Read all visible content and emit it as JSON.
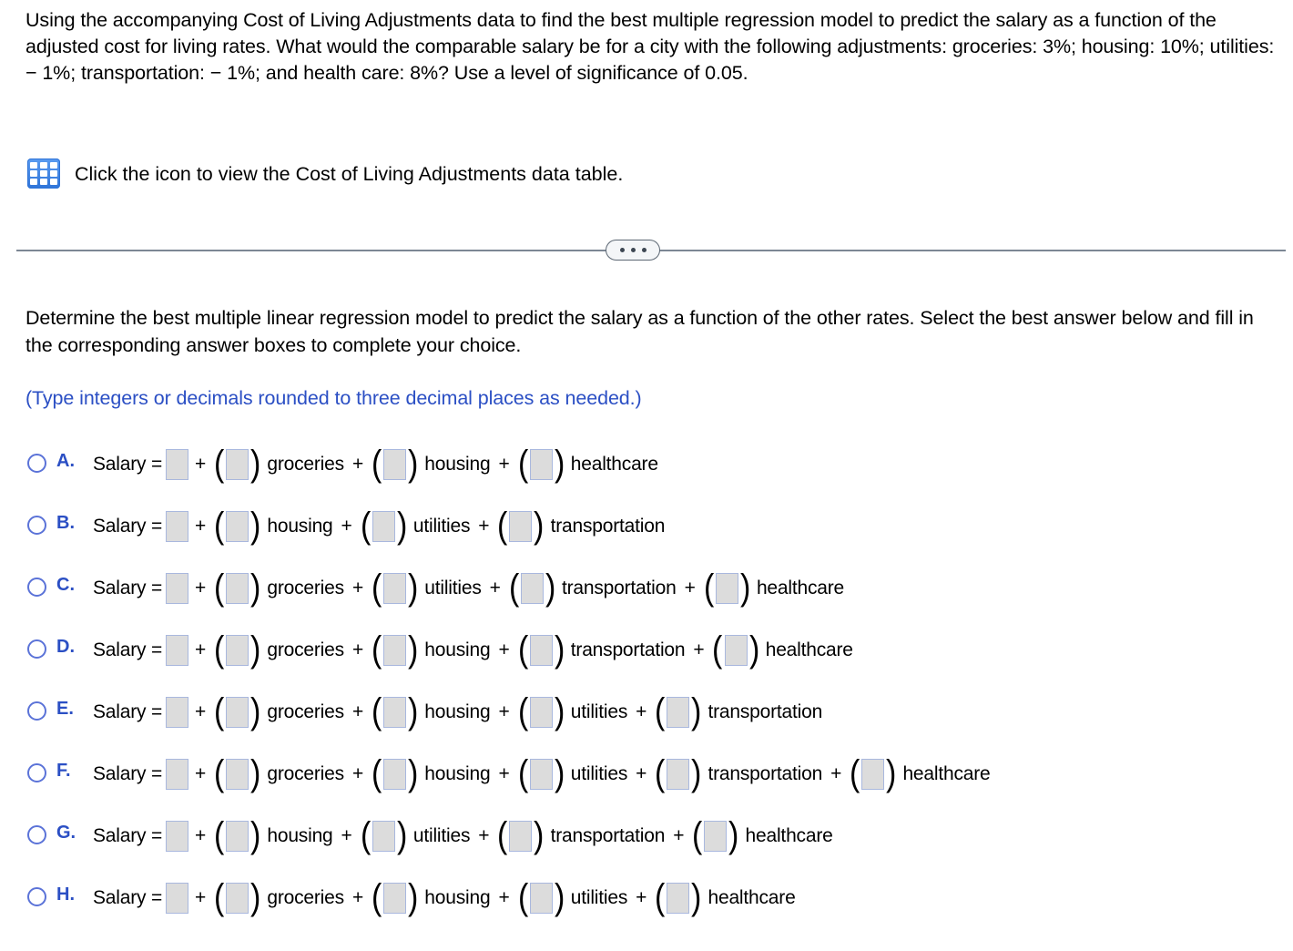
{
  "question": {
    "stem": "Using the accompanying Cost of Living Adjustments data to find the best multiple regression model to predict the salary as a function of the adjusted cost for living rates. What would the comparable salary be for a city with the following adjustments: groceries: 3%; housing: 10%; utilities:  − 1%; transportation:  − 1%; and health care: 8%? Use a level of significance of 0.05.",
    "data_link_text": "Click the icon to view the Cost of Living Adjustments data table.",
    "data_link_icon": "table-grid-icon"
  },
  "divider": {
    "ellipsis_icon": "ellipsis-horizontal-icon",
    "dot_count": 3
  },
  "instruction": {
    "text": "Determine the best multiple linear regression model to predict the salary as a function of the other rates. Select the best answer below and fill in the corresponding answer boxes to complete your choice.",
    "note": "(Type integers or decimals rounded to three decimal places as needed.)",
    "note_color": "#2b4fc4"
  },
  "answer_format": {
    "lhs": "Salary =",
    "plus": "+",
    "open_paren": "(",
    "close_paren": ")",
    "input_value": "",
    "input_placeholder": ""
  },
  "options": [
    {
      "letter": "A.",
      "terms": [
        "groceries",
        "housing",
        "healthcare"
      ],
      "selected": false
    },
    {
      "letter": "B.",
      "terms": [
        "housing",
        "utilities",
        "transportation"
      ],
      "selected": false
    },
    {
      "letter": "C.",
      "terms": [
        "groceries",
        "utilities",
        "transportation",
        "healthcare"
      ],
      "selected": false
    },
    {
      "letter": "D.",
      "terms": [
        "groceries",
        "housing",
        "transportation",
        "healthcare"
      ],
      "selected": false
    },
    {
      "letter": "E.",
      "terms": [
        "groceries",
        "housing",
        "utilities",
        "transportation"
      ],
      "selected": false
    },
    {
      "letter": "F.",
      "terms": [
        "groceries",
        "housing",
        "utilities",
        "transportation",
        "healthcare"
      ],
      "selected": false
    },
    {
      "letter": "G.",
      "terms": [
        "housing",
        "utilities",
        "transportation",
        "healthcare"
      ],
      "selected": false
    },
    {
      "letter": "H.",
      "terms": [
        "groceries",
        "housing",
        "utilities",
        "healthcare"
      ],
      "selected": false
    }
  ]
}
